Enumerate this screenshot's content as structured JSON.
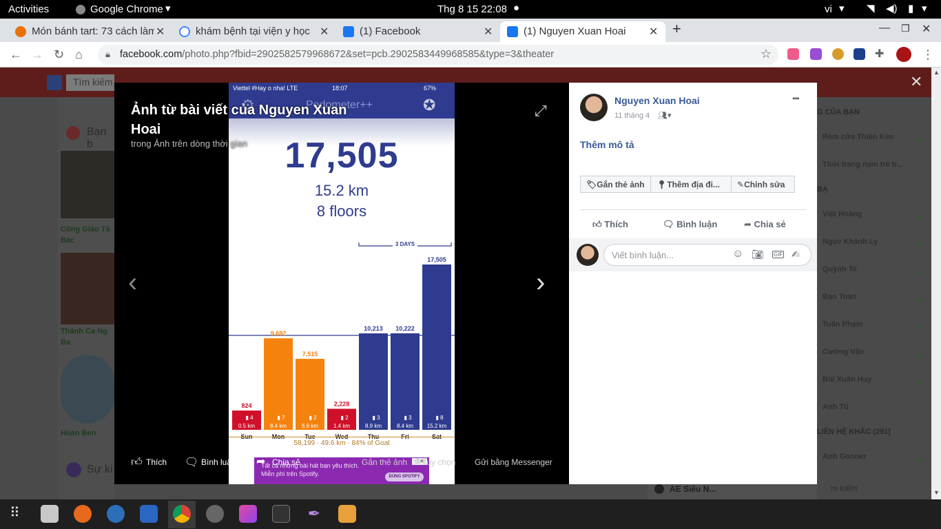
{
  "topbar": {
    "activities": "Activities",
    "app": "Google Chrome",
    "clock": "Thg 8 15  22:08",
    "lang": "vi"
  },
  "tabs": [
    {
      "title": "Món bánh tart: 73 cách làm",
      "favicon_color": "#e8710a"
    },
    {
      "title": "khám bệnh tại viện y học",
      "favicon_color": "#4285f4"
    },
    {
      "title": "(1) Facebook",
      "favicon_color": "#1877f2"
    },
    {
      "title": "(1) Nguyen Xuan Hoai",
      "favicon_color": "#1877f2"
    }
  ],
  "new_tab": "+",
  "url": {
    "domain": "facebook.com",
    "path": "/photo.php?fbid=2902582579968672&set=pcb.2902583449968585&type=3&theater"
  },
  "fb_background": {
    "search_placeholder": "Tìm kiếm",
    "left_items": [
      "Bạn b",
      "Công Giáo Tả",
      "Bác",
      "Thánh Ca Ng",
      "Ba",
      "Hoàn Ben",
      "Sự ki"
    ],
    "right_section": "G CỦA BẠN",
    "contacts_header": "BẠ",
    "right_items": [
      "Rèm cửa Thiên Kim",
      "Thời trang nam trẻ tr...",
      "Việt Hoàng",
      "Ngọc Khánh Ly",
      "Quỳnh Te",
      "Bạn Toàn",
      "Tuấn Phạm",
      "Cường Văn",
      "Bùi Xuân Huy",
      "Anh Tú",
      "LIÊN HỆ KHÁC (291)",
      "Anh Gooner"
    ],
    "chat_name": "AE Siêu N...",
    "chat_search": "m kiếm"
  },
  "theater": {
    "title": "Ảnh từ bài viết của Nguyen Xuan Hoai",
    "title_line1": "Ảnh từ bài viết của Nguyen Xuan",
    "title_line2": "Hoai",
    "subtitle": "trong Ảnh trên dòng thời gian",
    "actions": {
      "like": "Thích",
      "comment": "Bình luận",
      "share": "Chia sẻ",
      "tag": "Gắn thẻ ảnh",
      "options": "Tùy chọn",
      "messenger": "Gửi bằng Messenger"
    }
  },
  "phone": {
    "carrier": "Viettel #Hay o nha!  LTE",
    "time": "18:07",
    "battery": "67%",
    "app_title": "Pedometer++",
    "steps": "17,505",
    "distance": "15.2 km",
    "floors": "8 floors",
    "range_label": "3 DAYS",
    "summary": "58,199 · 49.6 km · 84% of Goal",
    "ad_text": "Tất cả những bài hát bạn yêu thích.",
    "ad_text2": "Miễn phí trên Spotify.",
    "ad_button": "DÙNG SPOTIFY"
  },
  "chart_data": {
    "type": "bar",
    "title": "",
    "categories": [
      "Sun",
      "Mon",
      "Tue",
      "Wed",
      "Thu",
      "Fri",
      "Sat"
    ],
    "series": [
      {
        "name": "",
        "values": [
          824,
          9692,
          7515,
          2228,
          10213,
          10222,
          17505
        ]
      }
    ],
    "floors": [
      4,
      7,
      2,
      2,
      3,
      3,
      8
    ],
    "distances": [
      "0.5 km",
      "8.4 km",
      "6.9 km",
      "1.4 km",
      "8.9 km",
      "8.4 km",
      "15.2 km"
    ],
    "value_labels": [
      "824",
      "9,692",
      "7,515",
      "2,228",
      "10,213",
      "10,222",
      "17,505"
    ],
    "bar_colors": [
      "#d0102a",
      "#f5820d",
      "#f5820d",
      "#d0102a",
      "#2f3b8f",
      "#2f3b8f",
      "#2f3b8f"
    ],
    "goal": 10000,
    "ylim": [
      0,
      17505
    ],
    "grid": false,
    "legend": "none"
  },
  "post": {
    "author": "Nguyen Xuan Hoai",
    "date": "11 tháng 4",
    "add_description": "Thêm mô tả",
    "chips": {
      "tag": "Gắn thẻ ảnh",
      "location": "Thêm địa đi...",
      "edit": "Chỉnh sửa"
    },
    "actions": {
      "like": "Thích",
      "comment": "Bình luận",
      "share": "Chia sẻ"
    },
    "comment_placeholder": "Viết bình luận...",
    "more": "•••"
  },
  "colors": {
    "fb_blue": "#385898",
    "pedometer_blue": "#2f3b8f",
    "orange": "#f5820d",
    "red": "#d0102a"
  }
}
